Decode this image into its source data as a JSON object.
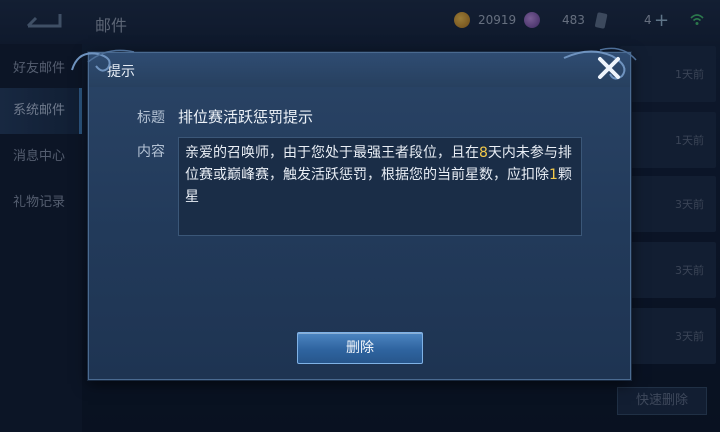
{
  "topbar": {
    "title": "邮件",
    "gold": "20919",
    "gems": "483",
    "vouchers": "4"
  },
  "sidebar": {
    "items": [
      {
        "label": "好友邮件"
      },
      {
        "label": "系统邮件"
      },
      {
        "label": "消息中心"
      },
      {
        "label": "礼物记录"
      }
    ]
  },
  "mail_list": {
    "rows": [
      {
        "time": "1天前"
      },
      {
        "time": "1天前"
      },
      {
        "time": "3天前"
      },
      {
        "time": "3天前"
      },
      {
        "time": "3天前"
      }
    ],
    "quick_delete_label": "快速删除"
  },
  "dialog": {
    "title": "提示",
    "subject_label": "标题",
    "subject": "排位赛活跃惩罚提示",
    "content_label": "内容",
    "content_parts": {
      "p1": "亲爱的召唤师，由于您处于最强王者段位，且在",
      "days": "8",
      "p2": "天内未参与排位赛或巅峰赛，触发活跃惩罚，根据您的当前星数，应扣除",
      "stars": "1",
      "p3": "颗星"
    },
    "delete_label": "删除"
  },
  "colors": {
    "highlight": "#f2c94a",
    "button": "#3a74b0",
    "dialog_bg": "#24405f"
  }
}
